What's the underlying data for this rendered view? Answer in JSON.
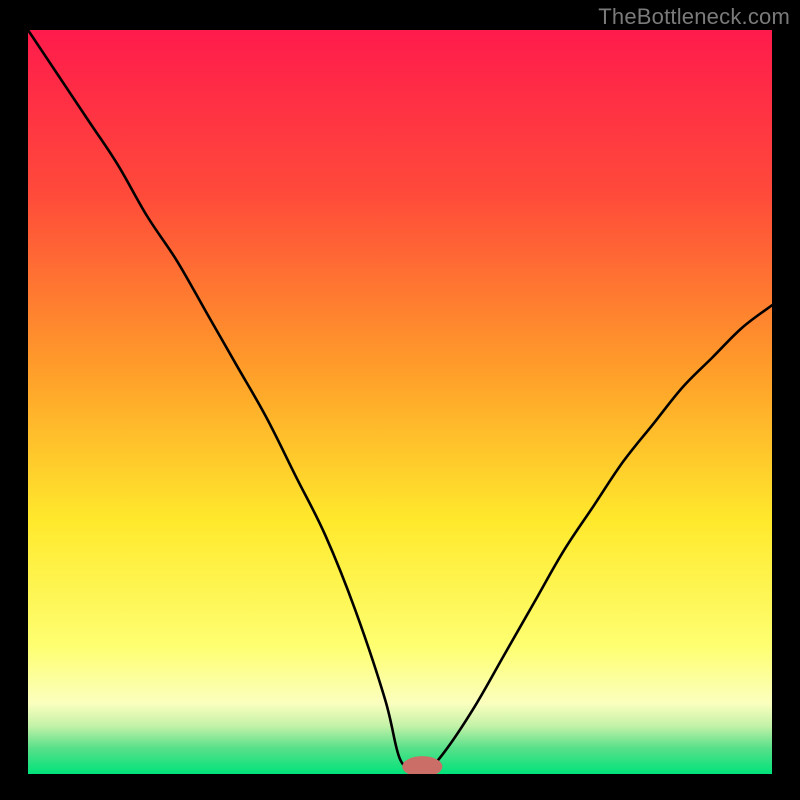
{
  "watermark": "TheBottleneck.com",
  "colors": {
    "red_top": "#ff1b4c",
    "orange": "#ff8e2a",
    "yellow": "#ffe92c",
    "pale_yellow": "#feff9f",
    "green_band": "#8fe38f",
    "green_bottom": "#00e27a",
    "curve": "#000000",
    "marker": "#cc6e68",
    "frame": "#000000"
  },
  "chart_data": {
    "type": "line",
    "title": "",
    "xlabel": "",
    "ylabel": "",
    "xlim": [
      0,
      100
    ],
    "ylim": [
      0,
      100
    ],
    "grid": false,
    "legend": false,
    "series": [
      {
        "name": "bottleneck-curve",
        "x": [
          0,
          4,
          8,
          12,
          16,
          20,
          24,
          28,
          32,
          36,
          40,
          44,
          48,
          50,
          52,
          54,
          56,
          60,
          64,
          68,
          72,
          76,
          80,
          84,
          88,
          92,
          96,
          100
        ],
        "y": [
          100,
          94,
          88,
          82,
          75,
          69,
          62,
          55,
          48,
          40,
          32,
          22,
          10,
          2,
          1,
          1,
          3,
          9,
          16,
          23,
          30,
          36,
          42,
          47,
          52,
          56,
          60,
          63
        ]
      }
    ],
    "marker": {
      "x": 53,
      "y": 1,
      "rx": 2.7,
      "ry": 1.4
    },
    "background_gradient": [
      {
        "pos": 0.0,
        "color": "#ff1b4c"
      },
      {
        "pos": 0.22,
        "color": "#ff4a3a"
      },
      {
        "pos": 0.45,
        "color": "#ff9b2a"
      },
      {
        "pos": 0.66,
        "color": "#ffe92c"
      },
      {
        "pos": 0.83,
        "color": "#feff72"
      },
      {
        "pos": 0.905,
        "color": "#fbffbe"
      },
      {
        "pos": 0.935,
        "color": "#c4f2a8"
      },
      {
        "pos": 0.965,
        "color": "#59e08a"
      },
      {
        "pos": 1.0,
        "color": "#00e27a"
      }
    ]
  }
}
